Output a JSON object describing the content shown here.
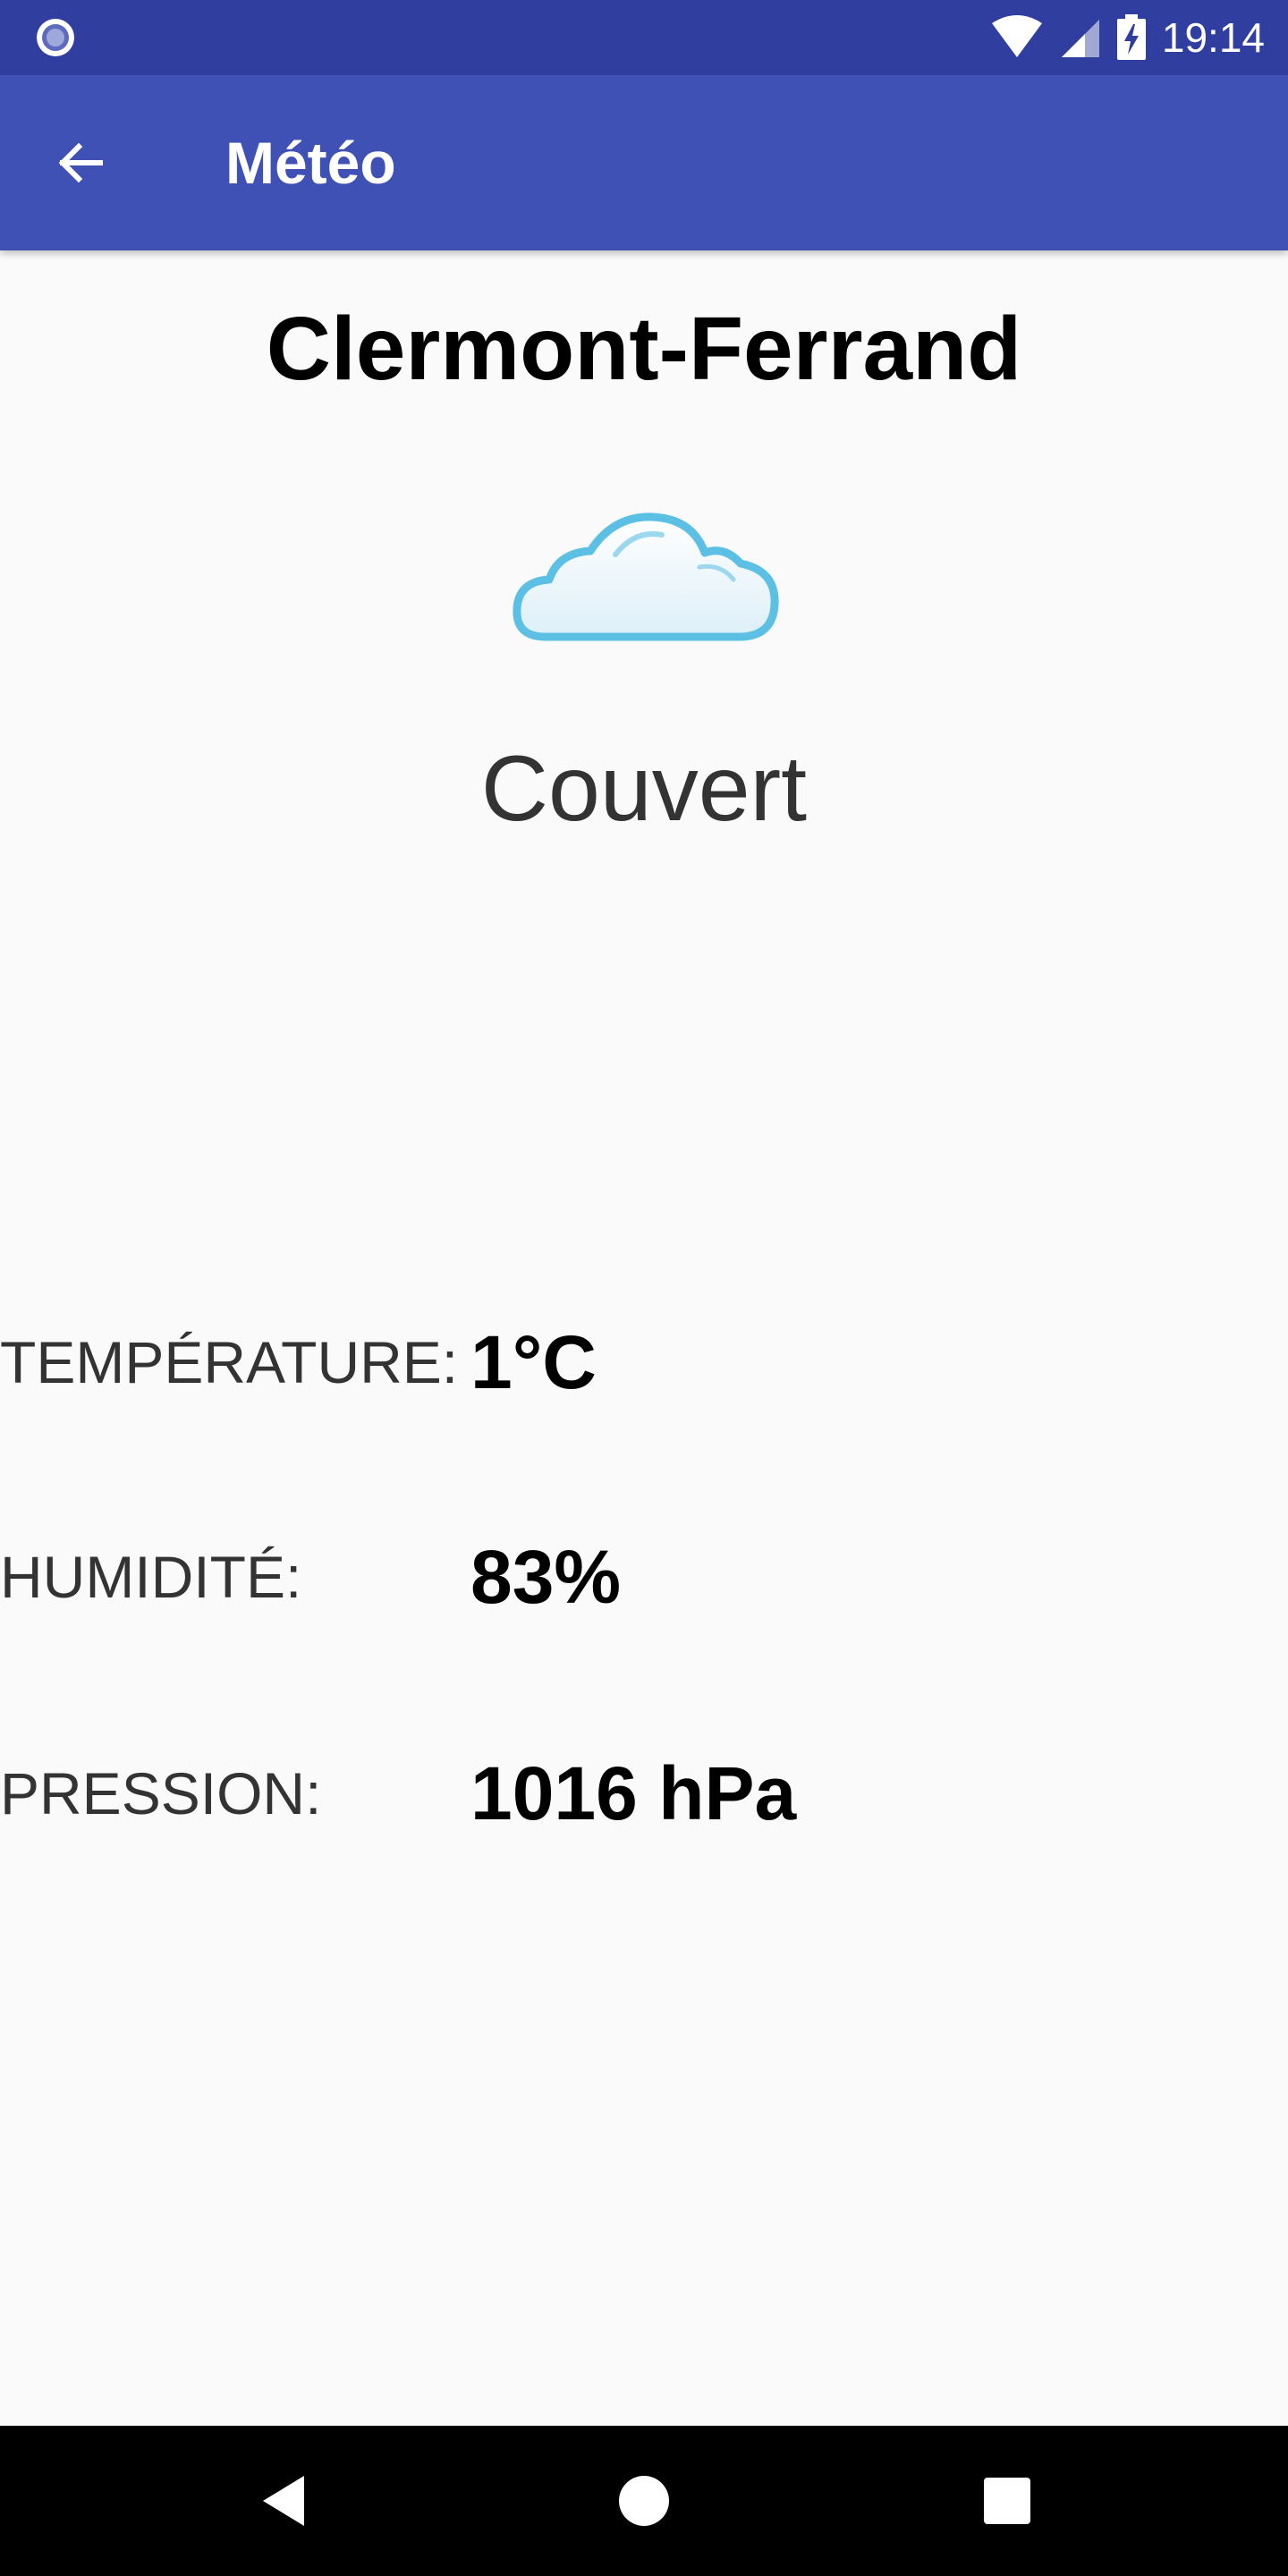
{
  "status_bar": {
    "time": "19:14",
    "background": "#303F9F"
  },
  "app_bar": {
    "title": "Météo",
    "back_icon": "arrow-left-icon",
    "background": "#3F51B5"
  },
  "weather": {
    "city": "Clermont-Ferrand",
    "icon": "cloud-icon",
    "description": "Couvert",
    "details": [
      {
        "label": "TEMPÉRATURE:",
        "value": "1°C"
      },
      {
        "label": "HUMIDITÉ:",
        "value": "83%"
      },
      {
        "label": "PRESSION:",
        "value": "1016 hPa"
      }
    ]
  },
  "nav_bar": {
    "back_icon": "triangle-back-icon",
    "home_icon": "circle-home-icon",
    "recents_icon": "square-recents-icon"
  }
}
